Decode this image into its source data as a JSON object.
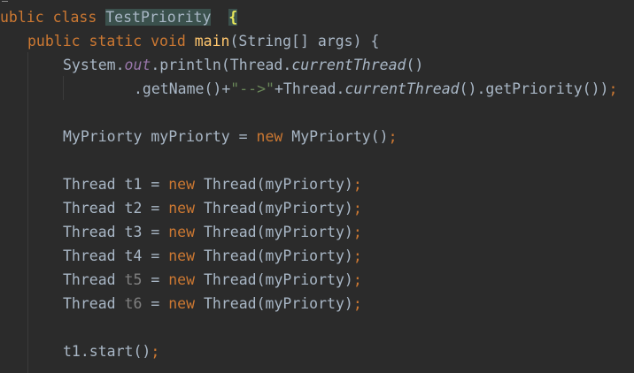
{
  "code": {
    "line1": {
      "kw": "ublic class ",
      "cls": "TestPriority",
      "gap": "  ",
      "brace": "{"
    },
    "line2": {
      "kw": "public static void ",
      "method": "main",
      "rest": "(String[] args) {"
    },
    "line3": {
      "a": "System.",
      "field": "out",
      "b": ".println(Thread.",
      "call": "currentThread",
      "c": "()"
    },
    "line4": {
      "a": ".getName()+",
      "str": "\"-->\"",
      "b": "+Thread.",
      "call": "currentThread",
      "c": "().getPriority())",
      "semi": ";"
    },
    "line5": {
      "a": "MyPriorty myPriorty = ",
      "kw": "new",
      "b": " MyPriorty()",
      "semi": ";"
    },
    "threads": [
      {
        "type": "Thread ",
        "var": "t1",
        "eq": " = ",
        "kw": "new",
        "rest": " Thread(myPriorty)",
        "semi": ";"
      },
      {
        "type": "Thread ",
        "var": "t2",
        "eq": " = ",
        "kw": "new",
        "rest": " Thread(myPriorty)",
        "semi": ";"
      },
      {
        "type": "Thread ",
        "var": "t3",
        "eq": " = ",
        "kw": "new",
        "rest": " Thread(myPriorty)",
        "semi": ";"
      },
      {
        "type": "Thread ",
        "var": "t4",
        "eq": " = ",
        "kw": "new",
        "rest": " Thread(myPriorty)",
        "semi": ";"
      },
      {
        "type": "Thread ",
        "var": "t5",
        "eq": " = ",
        "kw": "new",
        "rest": " Thread(myPriorty)",
        "semi": ";"
      },
      {
        "type": "Thread ",
        "var": "t6",
        "eq": " = ",
        "kw": "new",
        "rest": " Thread(myPriorty)",
        "semi": ";"
      }
    ],
    "line12": {
      "a": "t1.start()",
      "semi": ";"
    }
  }
}
